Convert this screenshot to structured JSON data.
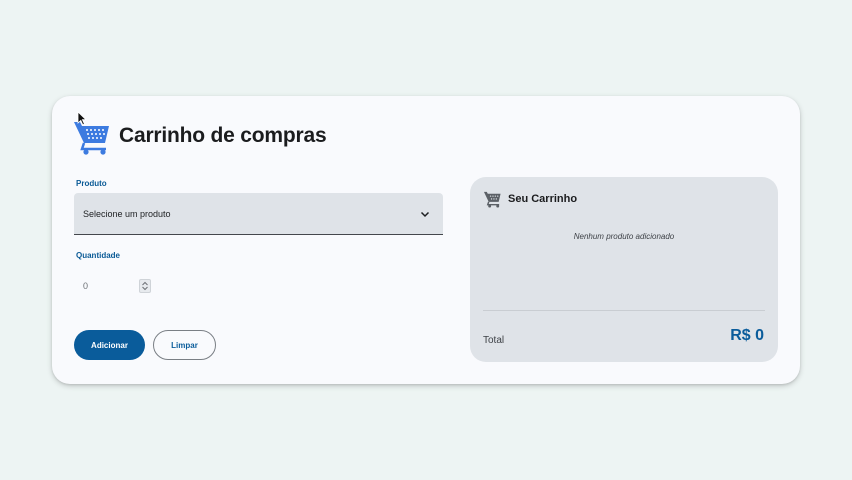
{
  "title": "Carrinho de compras",
  "form": {
    "product_label": "Produto",
    "product_placeholder": "Selecione um produto",
    "quantity_label": "Quantidade",
    "quantity_value": "0",
    "add_button": "Adicionar",
    "clear_button": "Limpar"
  },
  "cart": {
    "title": "Seu Carrinho",
    "empty_message": "Nenhum produto adicionado",
    "total_label": "Total",
    "total_value": "R$ 0"
  },
  "icons": {
    "header": "shopping-cart-icon",
    "select": "chevron-down-icon",
    "spin": "spinner-arrows-icon",
    "cart": "shopping-cart-icon"
  },
  "colors": {
    "accent": "#0a5c9b",
    "label": "#0a5a96",
    "cart_icon": "#3d7be0",
    "panel": "#dfe3e8",
    "background": "#edf4f3"
  }
}
